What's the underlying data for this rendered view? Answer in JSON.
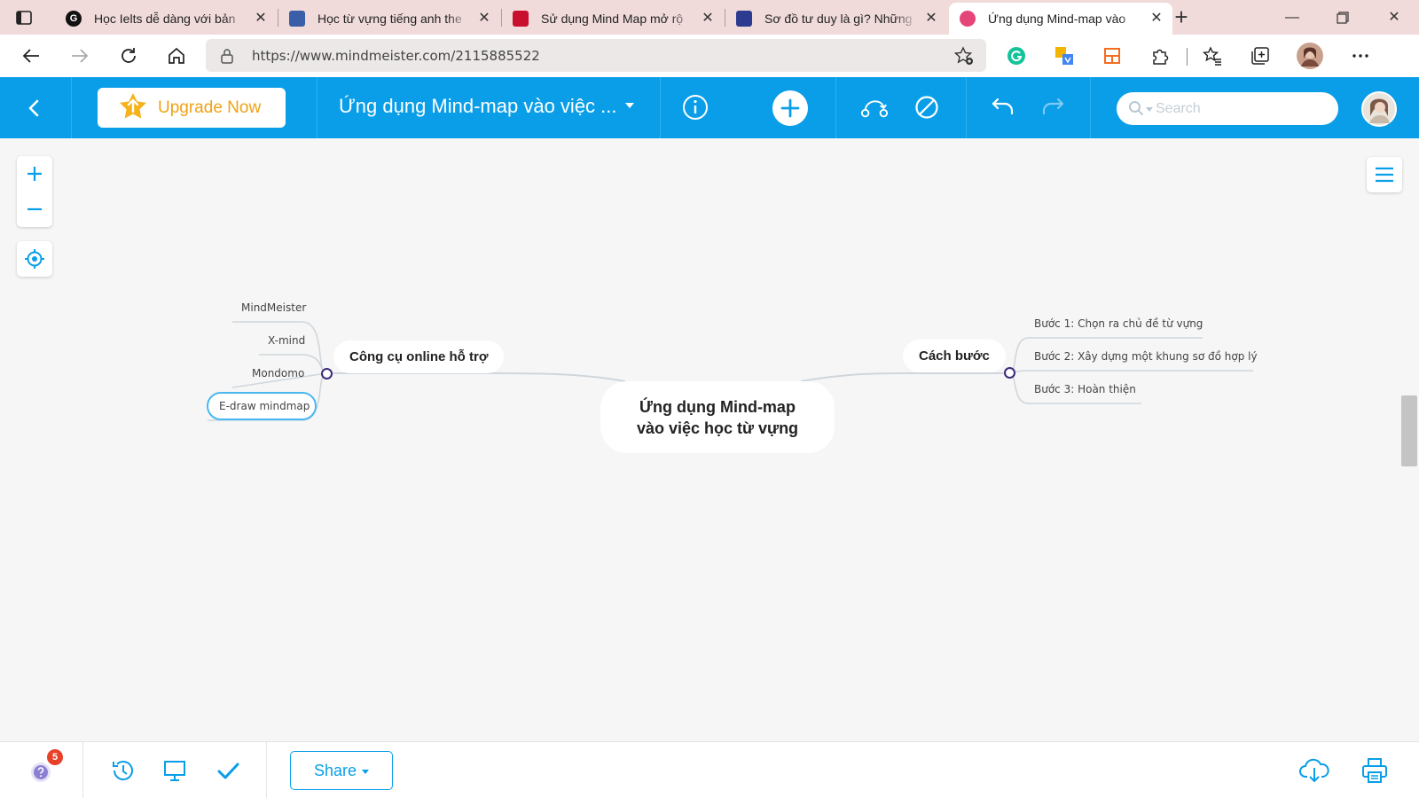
{
  "browser": {
    "tabs": [
      {
        "title": "Học Ielts dễ dàng với bản",
        "favicon": "G",
        "favicon_color": "#111111"
      },
      {
        "title": "Học từ vựng tiếng anh the",
        "favicon": "",
        "favicon_color": "#3b5ea8"
      },
      {
        "title": "Sử dụng Mind Map mở rộ",
        "favicon": "",
        "favicon_color": "#c8102e"
      },
      {
        "title": "Sơ đồ tư duy là gì? Những",
        "favicon": "",
        "favicon_color": "#2c3b8f"
      },
      {
        "title": "Ứng dụng Mind-map vào",
        "favicon": "",
        "favicon_color": "#e6457a",
        "active": true
      }
    ],
    "url": "https://www.mindmeister.com/2115885522"
  },
  "toolbar": {
    "upgrade_label": "Upgrade Now",
    "map_title": "Ứng dụng Mind-map vào việc ...",
    "search_placeholder": "Search",
    "accent_color": "#0a9ee8",
    "upgrade_color": "#f0a214"
  },
  "mindmap": {
    "root": {
      "line1": "Ứng dụng Mind-map",
      "line2": "vào việc học từ vựng"
    },
    "left_topic": {
      "label": "Công cụ online hỗ trợ",
      "children": [
        "MindMeister",
        "X-mind",
        "Mondomo",
        "E-draw mindmap"
      ]
    },
    "right_topic": {
      "label": "Cách bước",
      "children": [
        "Bước 1: Chọn ra chủ đề từ vựng",
        "Bước 2: Xây dựng một khung sơ đồ hợp lý",
        "Bước 3: Hoàn thiện"
      ]
    },
    "selected_node": "E-draw mindmap"
  },
  "bottom": {
    "help_badge": "5",
    "share_label": "Share"
  }
}
